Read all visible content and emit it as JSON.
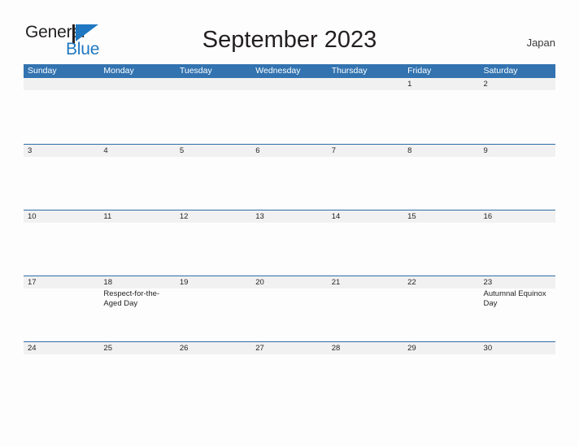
{
  "brand": {
    "name_part1": "General",
    "name_part2": "Blue",
    "flag_icon": "blue-triangle-flag",
    "accent_color": "#1F78C1"
  },
  "header": {
    "title": "September 2023",
    "country": "Japan"
  },
  "theme": {
    "header_blue": "#3273B0",
    "row_line_blue": "#2E6DA8",
    "day_band_gray": "#F1F1F1",
    "page_background": "#FDFDFD",
    "text_color": "#231F20"
  },
  "calendar": {
    "weekday_headers": [
      "Sunday",
      "Monday",
      "Tuesday",
      "Wednesday",
      "Thursday",
      "Friday",
      "Saturday"
    ],
    "weeks": [
      [
        {
          "day": "",
          "events": []
        },
        {
          "day": "",
          "events": []
        },
        {
          "day": "",
          "events": []
        },
        {
          "day": "",
          "events": []
        },
        {
          "day": "",
          "events": []
        },
        {
          "day": "1",
          "events": []
        },
        {
          "day": "2",
          "events": []
        }
      ],
      [
        {
          "day": "3",
          "events": []
        },
        {
          "day": "4",
          "events": []
        },
        {
          "day": "5",
          "events": []
        },
        {
          "day": "6",
          "events": []
        },
        {
          "day": "7",
          "events": []
        },
        {
          "day": "8",
          "events": []
        },
        {
          "day": "9",
          "events": []
        }
      ],
      [
        {
          "day": "10",
          "events": []
        },
        {
          "day": "11",
          "events": []
        },
        {
          "day": "12",
          "events": []
        },
        {
          "day": "13",
          "events": []
        },
        {
          "day": "14",
          "events": []
        },
        {
          "day": "15",
          "events": []
        },
        {
          "day": "16",
          "events": []
        }
      ],
      [
        {
          "day": "17",
          "events": []
        },
        {
          "day": "18",
          "events": [
            "Respect-for-the-Aged Day"
          ]
        },
        {
          "day": "19",
          "events": []
        },
        {
          "day": "20",
          "events": []
        },
        {
          "day": "21",
          "events": []
        },
        {
          "day": "22",
          "events": []
        },
        {
          "day": "23",
          "events": [
            "Autumnal Equinox Day"
          ]
        }
      ],
      [
        {
          "day": "24",
          "events": []
        },
        {
          "day": "25",
          "events": []
        },
        {
          "day": "26",
          "events": []
        },
        {
          "day": "27",
          "events": []
        },
        {
          "day": "28",
          "events": []
        },
        {
          "day": "29",
          "events": []
        },
        {
          "day": "30",
          "events": []
        }
      ]
    ]
  }
}
